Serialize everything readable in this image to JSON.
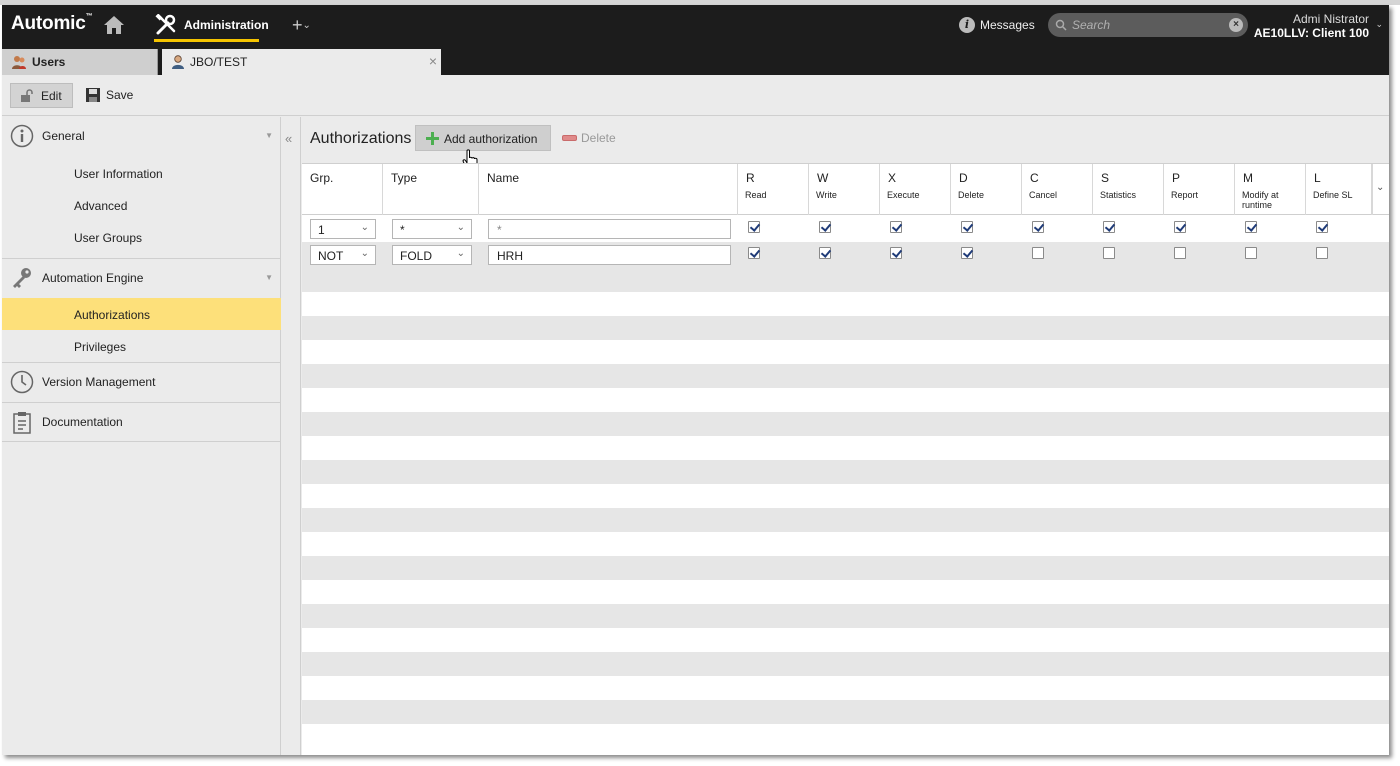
{
  "app": {
    "logo": "Automic",
    "logo_mark": "™",
    "module": "Administration",
    "plus": "+",
    "messages": "Messages",
    "search_placeholder": "Search",
    "user_name": "Admi Nistrator",
    "client": "AE10LLV: Client 100"
  },
  "tabs": [
    {
      "label": "Users",
      "icon": "users-icon"
    },
    {
      "label": "JBO/TEST",
      "icon": "user-icon",
      "close": "×"
    }
  ],
  "toolbar": {
    "edit": "Edit",
    "save": "Save"
  },
  "sidebar": {
    "sections": [
      {
        "label": "General",
        "icon": "info-icon",
        "items": [
          "User Information",
          "Advanced",
          "User Groups"
        ]
      },
      {
        "label": "Automation Engine",
        "icon": "key-icon",
        "items": [
          "Authorizations",
          "Privileges"
        ]
      },
      {
        "label": "Version Management",
        "icon": "clock-icon",
        "items": []
      },
      {
        "label": "Documentation",
        "icon": "clipboard-icon",
        "items": []
      }
    ],
    "active_item": "Authorizations",
    "collapse": "«"
  },
  "main": {
    "title": "Authorizations",
    "add_button": "Add authorization",
    "delete_button": "Delete",
    "columns": [
      {
        "letter": "Grp.",
        "sub": ""
      },
      {
        "letter": "Type",
        "sub": ""
      },
      {
        "letter": "Name",
        "sub": ""
      },
      {
        "letter": "R",
        "sub": "Read"
      },
      {
        "letter": "W",
        "sub": "Write"
      },
      {
        "letter": "X",
        "sub": "Execute"
      },
      {
        "letter": "D",
        "sub": "Delete"
      },
      {
        "letter": "C",
        "sub": "Cancel"
      },
      {
        "letter": "S",
        "sub": "Statistics"
      },
      {
        "letter": "P",
        "sub": "Report"
      },
      {
        "letter": "M",
        "sub": "Modify at runtime"
      },
      {
        "letter": "L",
        "sub": "Define SL"
      }
    ],
    "rows": [
      {
        "grp": "1",
        "type": "*",
        "name": "*",
        "rights": [
          true,
          true,
          true,
          true,
          true,
          true,
          true,
          true,
          true
        ]
      },
      {
        "grp": "NOT",
        "type": "FOLD",
        "name": "HRH",
        "rights": [
          true,
          true,
          true,
          true,
          false,
          false,
          false,
          false,
          false
        ]
      }
    ],
    "empty_rows": 20
  },
  "colors": {
    "topbar": "#1c1c1c",
    "accent": "#f5c400",
    "active_item": "#fde07a"
  }
}
